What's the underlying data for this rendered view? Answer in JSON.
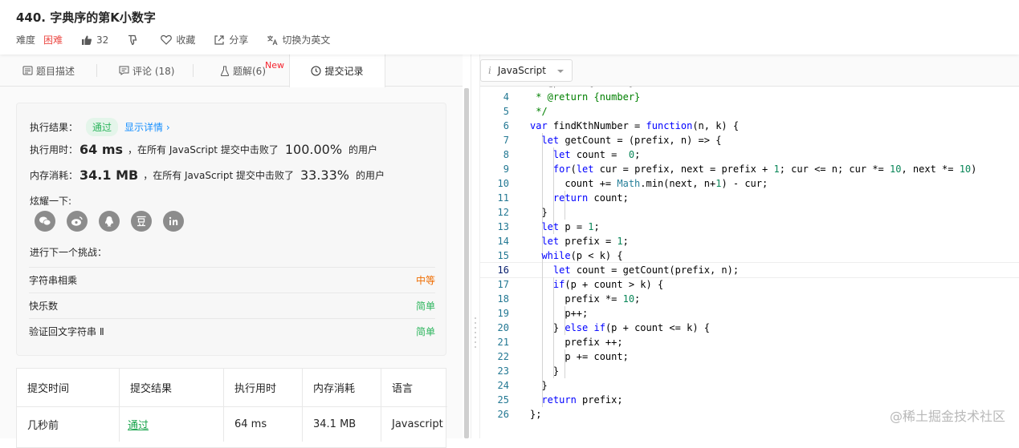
{
  "problem": {
    "title": "440. 字典序的第K小数字",
    "difficulty_label": "难度",
    "difficulty": "困难",
    "likes": "32",
    "favorite": "收藏",
    "share": "分享",
    "translate": "切换为英文"
  },
  "tabs": {
    "description": "题目描述",
    "comments": "评论 (18)",
    "solutions": "题解(6)",
    "solutions_badge": "New",
    "submissions": "提交记录"
  },
  "result": {
    "label": "执行结果：",
    "status": "通过",
    "details": "显示详情",
    "runtime_label": "执行用时：",
    "runtime": "64 ms",
    "runtime_text": "，在所有 JavaScript 提交中击败了",
    "runtime_pct": "100.00%",
    "runtime_suffix": "的用户",
    "memory_label": "内存消耗：",
    "memory": "34.1 MB",
    "memory_text": "，在所有 JavaScript 提交中击败了",
    "memory_pct": "33.33%",
    "memory_suffix": "的用户",
    "share_label": "炫耀一下:",
    "next_label": "进行下一个挑战：",
    "challenges": [
      {
        "name": "字符串相乘",
        "level": "中等"
      },
      {
        "name": "快乐数",
        "level": "简单"
      },
      {
        "name": "验证回文字符串 Ⅱ",
        "level": "简单"
      }
    ]
  },
  "submissions_table": {
    "headers": [
      "提交时间",
      "提交结果",
      "执行用时",
      "内存消耗",
      "语言"
    ],
    "rows": [
      [
        "几秒前",
        "通过",
        "64 ms",
        "34.1 MB",
        "Javascript"
      ]
    ]
  },
  "editor": {
    "language": "JavaScript",
    "line_numbers": [
      "4",
      "5",
      "6",
      "7",
      "8",
      "9",
      "10",
      "11",
      "12",
      "13",
      "14",
      "15",
      "16",
      "17",
      "18",
      "19",
      "20",
      "21",
      "22",
      "23",
      "24",
      "25",
      "26"
    ]
  },
  "watermark": "@稀土掘金技术社区"
}
